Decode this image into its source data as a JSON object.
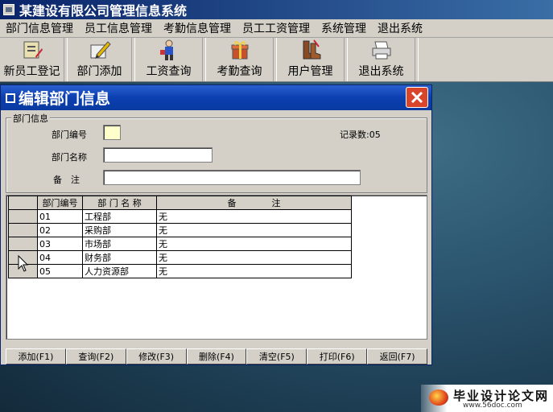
{
  "app": {
    "title": "某建设有限公司管理信息系统"
  },
  "menubar": {
    "items": [
      "部门信息管理",
      "员工信息管理",
      "考勤信息管理",
      "员工工资管理",
      "系统管理",
      "退出系统"
    ]
  },
  "toolbar": {
    "buttons": [
      {
        "label": "新员工登记",
        "icon": "register-icon"
      },
      {
        "label": "部门添加",
        "icon": "edit-pencil-icon"
      },
      {
        "label": "工资查询",
        "icon": "person-icon"
      },
      {
        "label": "考勤查询",
        "icon": "gift-box-icon"
      },
      {
        "label": "用户管理",
        "icon": "boots-icon"
      },
      {
        "label": "退出系统",
        "icon": "printer-icon"
      }
    ]
  },
  "dialog": {
    "title": "编辑部门信息",
    "group_label": "部门信息",
    "fields": {
      "code_label": "部门编号",
      "code_value": "",
      "name_label": "部门名称",
      "name_value": "",
      "note_label": "备　注",
      "note_value": ""
    },
    "record_count_label": "记录数:05",
    "grid": {
      "columns": [
        "部门编号",
        "部 门 名 称",
        "备　　　　注"
      ],
      "rows": [
        [
          "01",
          "工程部",
          "无"
        ],
        [
          "02",
          "采购部",
          "无"
        ],
        [
          "03",
          "市场部",
          "无"
        ],
        [
          "04",
          "财务部",
          "无"
        ],
        [
          "05",
          "人力资源部",
          "无"
        ]
      ]
    },
    "buttons": [
      "添加(F1)",
      "查询(F2)",
      "修改(F3)",
      "删除(F4)",
      "清空(F5)",
      "打印(F6)",
      "返回(F7)"
    ]
  },
  "watermark": {
    "text": "毕业设计论文网",
    "url": "www.56doc.com"
  },
  "colors": {
    "title_blue": "#0a246a",
    "dialog_title": "#0b3fb0",
    "close_red": "#d9452b",
    "face": "#d4d0c8"
  }
}
